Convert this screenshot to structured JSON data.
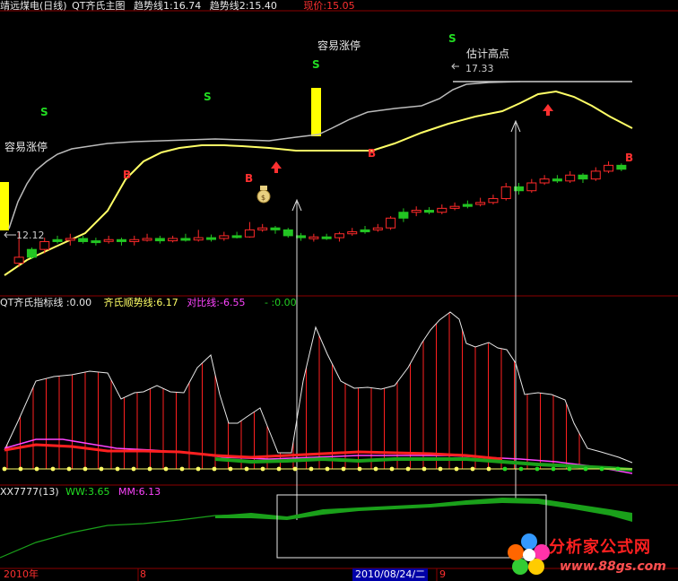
{
  "header": {
    "stock": "靖远煤电(日线)",
    "indicator": "QT齐氏主图",
    "trend1_label": "趋势线1:",
    "trend1_value": "16.74",
    "trend2_label": "趋势线2:",
    "trend2_value": "15.40",
    "price_label": "现价:",
    "price_value": "15.05"
  },
  "annotations": {
    "limit_up_left": "容易涨停",
    "limit_up_mid": "容易涨停",
    "est_high": "估计高点",
    "high_value": "17.33",
    "low_value": "12.12",
    "buy": "B",
    "sell": "S"
  },
  "sub1": {
    "name": "QT齐氏指标线",
    "value1": ":0.00",
    "shun_label": "齐氏顺势线:",
    "shun_value": "6.17",
    "dui_label": "对比线:",
    "dui_value": "-6.55",
    "extra": "- :0.00"
  },
  "sub2": {
    "name": "XX7777(13)",
    "ww_label": "WW:",
    "ww_value": "3.65",
    "mm_label": "MM:",
    "mm_value": "6.13"
  },
  "footer": {
    "year": "2010年",
    "mark1": "8",
    "date": "2010/08/24/二",
    "mark2": "9"
  },
  "watermark": {
    "title": "分析家公式网",
    "url": "www.88gs.com"
  },
  "colors": {
    "up": "#ff2a2a",
    "down": "#22c422",
    "yellow_line": "#ffff66",
    "grid": "#8b0000",
    "magenta": "#ff44ff"
  },
  "chart_data": {
    "type": "candlestick",
    "price_range": [
      12.12,
      17.33
    ],
    "candles": [
      [
        12.15,
        12.3,
        12.95,
        12.05,
        1
      ],
      [
        12.3,
        12.5,
        12.55,
        12.25,
        0
      ],
      [
        12.5,
        12.7,
        12.8,
        12.4,
        1
      ],
      [
        12.7,
        12.75,
        12.85,
        12.65,
        0
      ],
      [
        12.75,
        12.78,
        12.9,
        12.6,
        1
      ],
      [
        12.78,
        12.7,
        12.85,
        12.65,
        0
      ],
      [
        12.7,
        12.72,
        12.8,
        12.6,
        0
      ],
      [
        12.72,
        12.75,
        12.85,
        12.65,
        1
      ],
      [
        12.75,
        12.7,
        12.8,
        12.6,
        0
      ],
      [
        12.7,
        12.75,
        12.85,
        12.6,
        1
      ],
      [
        12.75,
        12.78,
        12.9,
        12.7,
        1
      ],
      [
        12.78,
        12.72,
        12.85,
        12.65,
        0
      ],
      [
        12.72,
        12.78,
        12.85,
        12.68,
        1
      ],
      [
        12.78,
        12.74,
        12.9,
        12.7,
        0
      ],
      [
        12.74,
        12.8,
        13.0,
        12.7,
        1
      ],
      [
        12.8,
        12.78,
        12.88,
        12.7,
        0
      ],
      [
        12.78,
        12.85,
        12.95,
        12.72,
        1
      ],
      [
        12.85,
        12.82,
        12.95,
        12.78,
        0
      ],
      [
        12.82,
        13.0,
        13.2,
        12.8,
        1
      ],
      [
        13.0,
        13.05,
        13.15,
        12.95,
        1
      ],
      [
        13.05,
        13.0,
        13.1,
        12.9,
        0
      ],
      [
        13.0,
        12.85,
        13.05,
        12.8,
        0
      ],
      [
        12.85,
        12.8,
        12.92,
        12.72,
        0
      ],
      [
        12.8,
        12.82,
        12.9,
        12.7,
        1
      ],
      [
        12.82,
        12.8,
        12.9,
        12.74,
        0
      ],
      [
        12.8,
        12.9,
        12.95,
        12.7,
        1
      ],
      [
        12.9,
        12.95,
        13.05,
        12.85,
        1
      ],
      [
        12.95,
        13.0,
        13.1,
        12.9,
        0
      ],
      [
        13.0,
        13.05,
        13.15,
        12.95,
        1
      ],
      [
        13.05,
        13.3,
        13.35,
        13.0,
        1
      ],
      [
        13.3,
        13.45,
        13.55,
        13.2,
        0
      ],
      [
        13.45,
        13.5,
        13.6,
        13.35,
        1
      ],
      [
        13.5,
        13.45,
        13.58,
        13.4,
        0
      ],
      [
        13.45,
        13.55,
        13.65,
        13.4,
        1
      ],
      [
        13.55,
        13.6,
        13.7,
        13.5,
        1
      ],
      [
        13.6,
        13.65,
        13.75,
        13.55,
        0
      ],
      [
        13.65,
        13.7,
        13.82,
        13.6,
        1
      ],
      [
        13.7,
        13.8,
        13.9,
        13.65,
        1
      ],
      [
        13.8,
        14.1,
        14.2,
        13.75,
        1
      ],
      [
        14.1,
        14.0,
        14.2,
        13.9,
        0
      ],
      [
        14.0,
        14.2,
        14.3,
        13.95,
        1
      ],
      [
        14.2,
        14.3,
        14.4,
        14.15,
        1
      ],
      [
        14.3,
        14.25,
        14.4,
        14.2,
        0
      ],
      [
        14.25,
        14.4,
        14.5,
        14.2,
        1
      ],
      [
        14.4,
        14.3,
        14.45,
        14.2,
        0
      ],
      [
        14.3,
        14.5,
        14.6,
        14.25,
        1
      ],
      [
        14.5,
        14.65,
        14.75,
        14.45,
        1
      ],
      [
        14.65,
        14.55,
        14.7,
        14.5,
        0
      ]
    ],
    "ma_yellow": [
      12.12,
      12.4,
      12.9,
      13.4,
      13.9,
      14.3,
      14.6,
      14.75,
      14.8,
      14.85,
      14.9,
      14.95,
      14.95,
      14.95,
      14.95,
      14.95,
      15.0,
      15.15,
      15.35,
      15.5,
      15.55,
      15.6,
      15.75,
      15.95,
      16.1,
      16.3,
      16.2,
      15.9,
      15.5
    ],
    "sub1_ww_values": [
      0.8,
      1.2,
      2.2,
      3.0,
      2.8,
      1.2,
      0.4,
      0.3,
      0.6,
      1.0,
      0.5,
      0.3,
      0.6,
      0.9,
      0.4,
      0.1,
      0.0
    ],
    "sub2_mm_values": [
      6.13,
      6.4,
      6.8,
      7.2,
      7.6,
      7.9,
      8.1,
      8.2,
      8.3,
      8.4,
      8.5,
      8.4,
      8.2,
      7.9,
      7.5
    ]
  }
}
